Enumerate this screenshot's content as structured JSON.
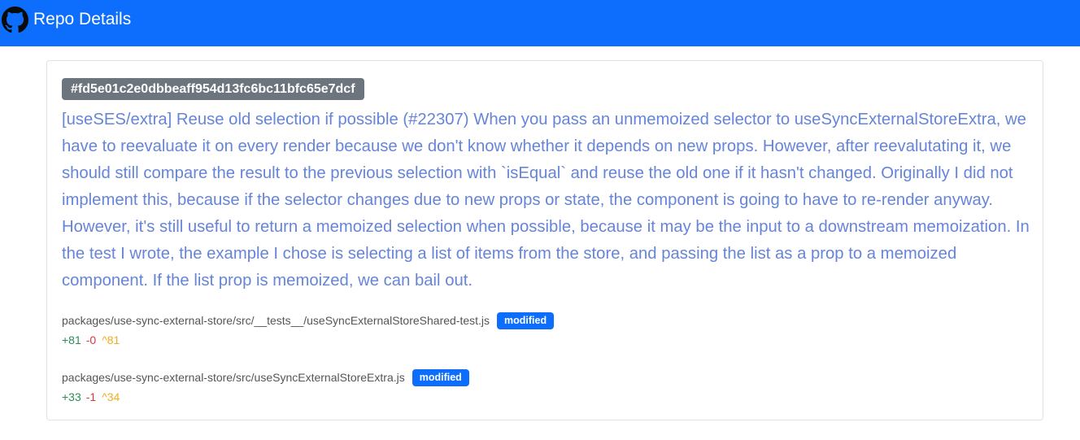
{
  "navbar": {
    "icon": "github-icon",
    "title": "Repo Details",
    "accent_color": "#0d6efd"
  },
  "commit": {
    "sha": "#fd5e01c2e0dbbeaff954d13fc6bc11bfc65e7dcf",
    "message": "[useSES/extra] Reuse old selection if possible (#22307) When you pass an unmemoized selector to useSyncExternalStoreExtra, we have to reevaluate it on every render because we don't know whether it depends on new props. However, after reevalutating it, we should still compare the result to the previous selection with `isEqual` and reuse the old one if it hasn't changed. Originally I did not implement this, because if the selector changes due to new props or state, the component is going to have to re-render anyway. However, it's still useful to return a memoized selection when possible, because it may be the input to a downstream memoization. In the test I wrote, the example I chose is selecting a list of items from the store, and passing the list as a prop to a memoized component. If the list prop is memoized, we can bail out.",
    "files": [
      {
        "path": "packages/use-sync-external-store/src/__tests__/useSyncExternalStoreShared-test.js",
        "status": "modified",
        "additions": "+81",
        "deletions": "-0",
        "changes": "^81"
      },
      {
        "path": "packages/use-sync-external-store/src/useSyncExternalStoreExtra.js",
        "status": "modified",
        "additions": "+33",
        "deletions": "-1",
        "changes": "^34"
      }
    ]
  }
}
